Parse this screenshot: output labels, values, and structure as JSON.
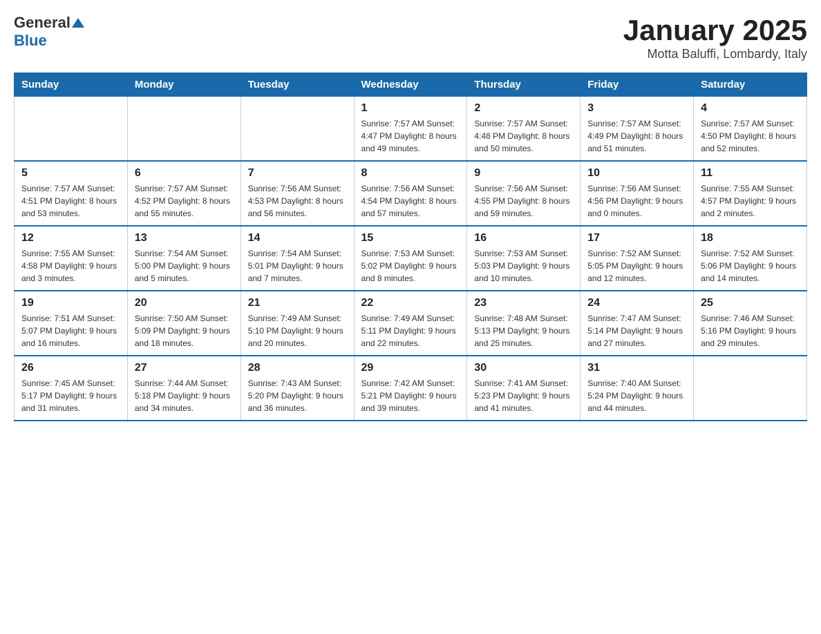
{
  "logo": {
    "general": "General",
    "blue": "Blue",
    "arrow": "▲"
  },
  "title": "January 2025",
  "subtitle": "Motta Baluffi, Lombardy, Italy",
  "weekdays": [
    "Sunday",
    "Monday",
    "Tuesday",
    "Wednesday",
    "Thursday",
    "Friday",
    "Saturday"
  ],
  "weeks": [
    [
      {
        "day": "",
        "info": ""
      },
      {
        "day": "",
        "info": ""
      },
      {
        "day": "",
        "info": ""
      },
      {
        "day": "1",
        "info": "Sunrise: 7:57 AM\nSunset: 4:47 PM\nDaylight: 8 hours\nand 49 minutes."
      },
      {
        "day": "2",
        "info": "Sunrise: 7:57 AM\nSunset: 4:48 PM\nDaylight: 8 hours\nand 50 minutes."
      },
      {
        "day": "3",
        "info": "Sunrise: 7:57 AM\nSunset: 4:49 PM\nDaylight: 8 hours\nand 51 minutes."
      },
      {
        "day": "4",
        "info": "Sunrise: 7:57 AM\nSunset: 4:50 PM\nDaylight: 8 hours\nand 52 minutes."
      }
    ],
    [
      {
        "day": "5",
        "info": "Sunrise: 7:57 AM\nSunset: 4:51 PM\nDaylight: 8 hours\nand 53 minutes."
      },
      {
        "day": "6",
        "info": "Sunrise: 7:57 AM\nSunset: 4:52 PM\nDaylight: 8 hours\nand 55 minutes."
      },
      {
        "day": "7",
        "info": "Sunrise: 7:56 AM\nSunset: 4:53 PM\nDaylight: 8 hours\nand 56 minutes."
      },
      {
        "day": "8",
        "info": "Sunrise: 7:56 AM\nSunset: 4:54 PM\nDaylight: 8 hours\nand 57 minutes."
      },
      {
        "day": "9",
        "info": "Sunrise: 7:56 AM\nSunset: 4:55 PM\nDaylight: 8 hours\nand 59 minutes."
      },
      {
        "day": "10",
        "info": "Sunrise: 7:56 AM\nSunset: 4:56 PM\nDaylight: 9 hours\nand 0 minutes."
      },
      {
        "day": "11",
        "info": "Sunrise: 7:55 AM\nSunset: 4:57 PM\nDaylight: 9 hours\nand 2 minutes."
      }
    ],
    [
      {
        "day": "12",
        "info": "Sunrise: 7:55 AM\nSunset: 4:58 PM\nDaylight: 9 hours\nand 3 minutes."
      },
      {
        "day": "13",
        "info": "Sunrise: 7:54 AM\nSunset: 5:00 PM\nDaylight: 9 hours\nand 5 minutes."
      },
      {
        "day": "14",
        "info": "Sunrise: 7:54 AM\nSunset: 5:01 PM\nDaylight: 9 hours\nand 7 minutes."
      },
      {
        "day": "15",
        "info": "Sunrise: 7:53 AM\nSunset: 5:02 PM\nDaylight: 9 hours\nand 8 minutes."
      },
      {
        "day": "16",
        "info": "Sunrise: 7:53 AM\nSunset: 5:03 PM\nDaylight: 9 hours\nand 10 minutes."
      },
      {
        "day": "17",
        "info": "Sunrise: 7:52 AM\nSunset: 5:05 PM\nDaylight: 9 hours\nand 12 minutes."
      },
      {
        "day": "18",
        "info": "Sunrise: 7:52 AM\nSunset: 5:06 PM\nDaylight: 9 hours\nand 14 minutes."
      }
    ],
    [
      {
        "day": "19",
        "info": "Sunrise: 7:51 AM\nSunset: 5:07 PM\nDaylight: 9 hours\nand 16 minutes."
      },
      {
        "day": "20",
        "info": "Sunrise: 7:50 AM\nSunset: 5:09 PM\nDaylight: 9 hours\nand 18 minutes."
      },
      {
        "day": "21",
        "info": "Sunrise: 7:49 AM\nSunset: 5:10 PM\nDaylight: 9 hours\nand 20 minutes."
      },
      {
        "day": "22",
        "info": "Sunrise: 7:49 AM\nSunset: 5:11 PM\nDaylight: 9 hours\nand 22 minutes."
      },
      {
        "day": "23",
        "info": "Sunrise: 7:48 AM\nSunset: 5:13 PM\nDaylight: 9 hours\nand 25 minutes."
      },
      {
        "day": "24",
        "info": "Sunrise: 7:47 AM\nSunset: 5:14 PM\nDaylight: 9 hours\nand 27 minutes."
      },
      {
        "day": "25",
        "info": "Sunrise: 7:46 AM\nSunset: 5:16 PM\nDaylight: 9 hours\nand 29 minutes."
      }
    ],
    [
      {
        "day": "26",
        "info": "Sunrise: 7:45 AM\nSunset: 5:17 PM\nDaylight: 9 hours\nand 31 minutes."
      },
      {
        "day": "27",
        "info": "Sunrise: 7:44 AM\nSunset: 5:18 PM\nDaylight: 9 hours\nand 34 minutes."
      },
      {
        "day": "28",
        "info": "Sunrise: 7:43 AM\nSunset: 5:20 PM\nDaylight: 9 hours\nand 36 minutes."
      },
      {
        "day": "29",
        "info": "Sunrise: 7:42 AM\nSunset: 5:21 PM\nDaylight: 9 hours\nand 39 minutes."
      },
      {
        "day": "30",
        "info": "Sunrise: 7:41 AM\nSunset: 5:23 PM\nDaylight: 9 hours\nand 41 minutes."
      },
      {
        "day": "31",
        "info": "Sunrise: 7:40 AM\nSunset: 5:24 PM\nDaylight: 9 hours\nand 44 minutes."
      },
      {
        "day": "",
        "info": ""
      }
    ]
  ]
}
